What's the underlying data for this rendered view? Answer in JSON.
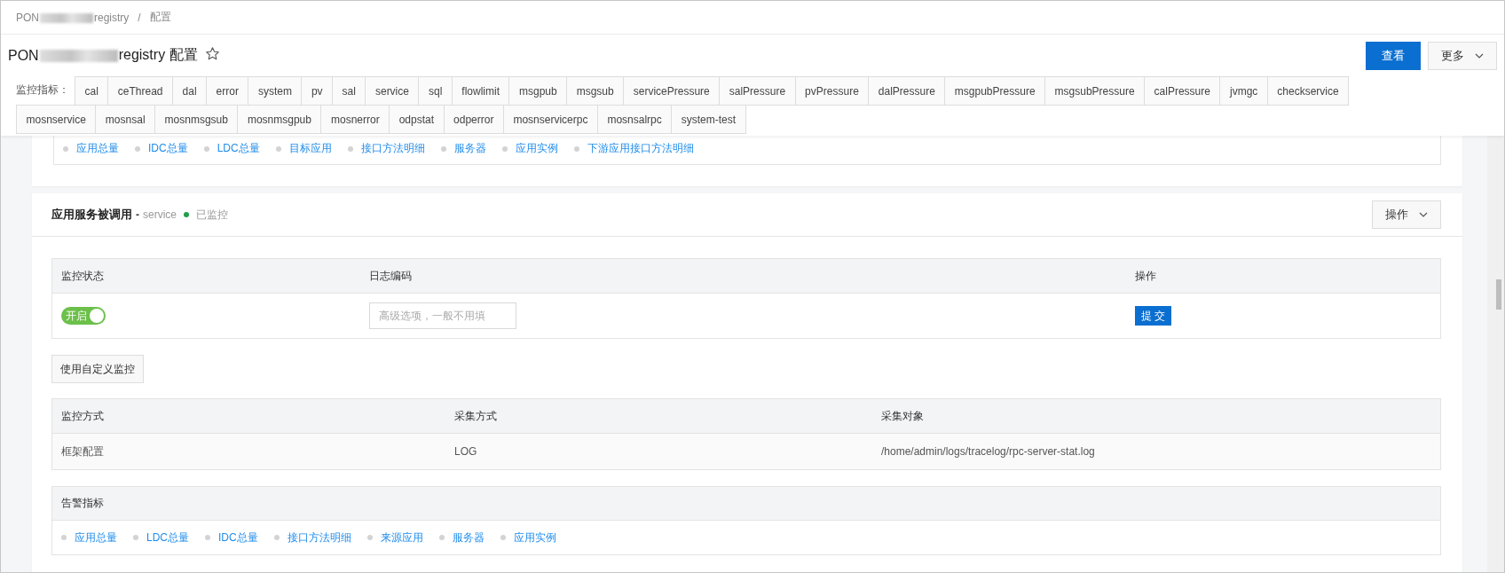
{
  "breadcrumb": {
    "separator": "/",
    "items": [
      {
        "parts": [
          "PON",
          "registry"
        ]
      },
      {
        "parts": [
          "配置"
        ]
      }
    ]
  },
  "title": {
    "parts": [
      "PON",
      "registry 配置"
    ],
    "favorite": false
  },
  "header_buttons": [
    {
      "label": "查看",
      "kind": "primary"
    },
    {
      "label": "更多",
      "kind": "dropdown"
    }
  ],
  "metrics": {
    "label": "监控指标：",
    "tabs": [
      "cal",
      "ceThread",
      "dal",
      "error",
      "system",
      "pv",
      "sal",
      "service",
      "sql",
      "flowlimit",
      "msgpub",
      "msgsub",
      "servicePressure",
      "salPressure",
      "pvPressure",
      "dalPressure",
      "msgpubPressure",
      "msgsubPressure",
      "calPressure",
      "jvmgc",
      "checkservice",
      "mosnservice",
      "mosnsal",
      "mosnmsgsub",
      "mosnmsgpub",
      "mosnerror",
      "odpstat",
      "odperror",
      "mosnservicerpc",
      "mosnsalrpc",
      "system-test"
    ]
  },
  "previous_card": {
    "links": [
      "应用总量",
      "IDC总量",
      "LDC总量",
      "目标应用",
      "接口方法明细",
      "服务器",
      "应用实例",
      "下游应用接口方法明细"
    ]
  },
  "service_card": {
    "title": "应用服务被调用",
    "type_separator": "-",
    "type": "service",
    "status": "已监控",
    "monitored": true,
    "action": "操作",
    "monitor_table": {
      "columns": [
        "监控状态",
        "日志编码",
        "操作"
      ],
      "toggle": {
        "label": "开启",
        "on": true
      },
      "log_code": {
        "placeholder": "高级选项，一般不用填"
      },
      "submit": "提 交"
    },
    "custom_button": "使用自定义监控",
    "method_table": {
      "columns": [
        "监控方式",
        "采集方式",
        "采集对象"
      ],
      "rows": [
        [
          "框架配置",
          "LOG",
          "/home/admin/logs/tracelog/rpc-server-stat.log"
        ]
      ]
    },
    "alarm": {
      "title": "告警指标",
      "links": [
        "应用总量",
        "LDC总量",
        "IDC总量",
        "接口方法明细",
        "来源应用",
        "服务器",
        "应用实例"
      ]
    }
  }
}
